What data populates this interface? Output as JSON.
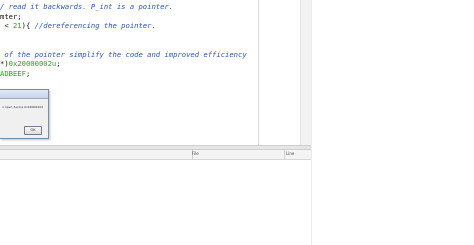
{
  "editor": {
    "lines": [
      {
        "parts": [
          {
            "cls": "cmt",
            "text": "/ read it backwards. P_int is a pointer."
          }
        ]
      },
      {
        "parts": [
          {
            "cls": "plain",
            "text": "mter;"
          }
        ]
      },
      {
        "parts": [
          {
            "cls": "plain",
            "text": " < "
          },
          {
            "cls": "num",
            "text": "21"
          },
          {
            "cls": "plain",
            "text": "){ "
          },
          {
            "cls": "cmt",
            "text": "//dereferencing the pointer."
          }
        ]
      },
      {
        "parts": [
          {
            "cls": "plain",
            "text": ""
          }
        ]
      },
      {
        "parts": [
          {
            "cls": "plain",
            "text": ""
          }
        ]
      },
      {
        "parts": [
          {
            "cls": "cmt",
            "text": " of the pointer simplify the code and improved efficiency"
          }
        ]
      },
      {
        "parts": [
          {
            "cls": "plain",
            "text": "*)"
          },
          {
            "cls": "num",
            "text": "0x20000002u"
          },
          {
            "cls": "plain",
            "text": ";"
          }
        ]
      },
      {
        "parts": [
          {
            "cls": "num",
            "text": "ADBEEF"
          },
          {
            "cls": "plain",
            "text": ";"
          }
        ]
      }
    ]
  },
  "output_panel": {
    "col_file": "File",
    "col_line": "Line"
  },
  "dialog": {
    "message": "n open device 0x00000002",
    "ok_label": "OK"
  }
}
